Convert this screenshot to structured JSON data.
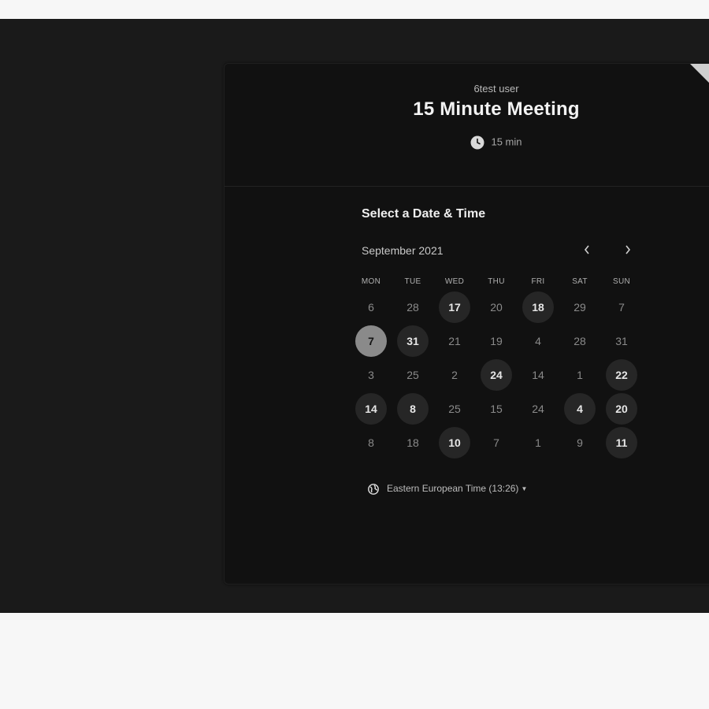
{
  "event": {
    "host": "6test user",
    "title": "15 Minute Meeting",
    "duration": "15 min"
  },
  "picker": {
    "heading": "Select a Date & Time",
    "month": "September 2021",
    "prev_icon": "chevron-left-icon",
    "next_icon": "chevron-right-icon",
    "weekdays": [
      "MON",
      "TUE",
      "WED",
      "THU",
      "FRI",
      "SAT",
      "SUN"
    ],
    "weeks": [
      [
        {
          "label": "6",
          "state": "disabled"
        },
        {
          "label": "28",
          "state": "disabled"
        },
        {
          "label": "17",
          "state": "available"
        },
        {
          "label": "20",
          "state": "disabled"
        },
        {
          "label": "18",
          "state": "available"
        },
        {
          "label": "29",
          "state": "disabled"
        },
        {
          "label": "7",
          "state": "disabled"
        }
      ],
      [
        {
          "label": "7",
          "state": "selected"
        },
        {
          "label": "31",
          "state": "available"
        },
        {
          "label": "21",
          "state": "disabled"
        },
        {
          "label": "19",
          "state": "disabled"
        },
        {
          "label": "4",
          "state": "disabled"
        },
        {
          "label": "28",
          "state": "disabled"
        },
        {
          "label": "31",
          "state": "disabled"
        }
      ],
      [
        {
          "label": "3",
          "state": "disabled"
        },
        {
          "label": "25",
          "state": "disabled"
        },
        {
          "label": "2",
          "state": "disabled"
        },
        {
          "label": "24",
          "state": "available"
        },
        {
          "label": "14",
          "state": "disabled"
        },
        {
          "label": "1",
          "state": "disabled"
        },
        {
          "label": "22",
          "state": "available"
        }
      ],
      [
        {
          "label": "14",
          "state": "available"
        },
        {
          "label": "8",
          "state": "available"
        },
        {
          "label": "25",
          "state": "disabled"
        },
        {
          "label": "15",
          "state": "disabled"
        },
        {
          "label": "24",
          "state": "disabled"
        },
        {
          "label": "4",
          "state": "available"
        },
        {
          "label": "20",
          "state": "available"
        }
      ],
      [
        {
          "label": "8",
          "state": "disabled"
        },
        {
          "label": "18",
          "state": "disabled"
        },
        {
          "label": "10",
          "state": "available"
        },
        {
          "label": "7",
          "state": "disabled"
        },
        {
          "label": "1",
          "state": "disabled"
        },
        {
          "label": "9",
          "state": "disabled"
        },
        {
          "label": "11",
          "state": "available"
        }
      ]
    ]
  },
  "timezone": {
    "label": "Eastern European Time (13:26)",
    "icon": "globe-icon"
  },
  "colors": {
    "page_background": "#1a1a1a",
    "card_background": "#111111",
    "available_day": "#262626",
    "selected_day": "#8a8a8a"
  }
}
